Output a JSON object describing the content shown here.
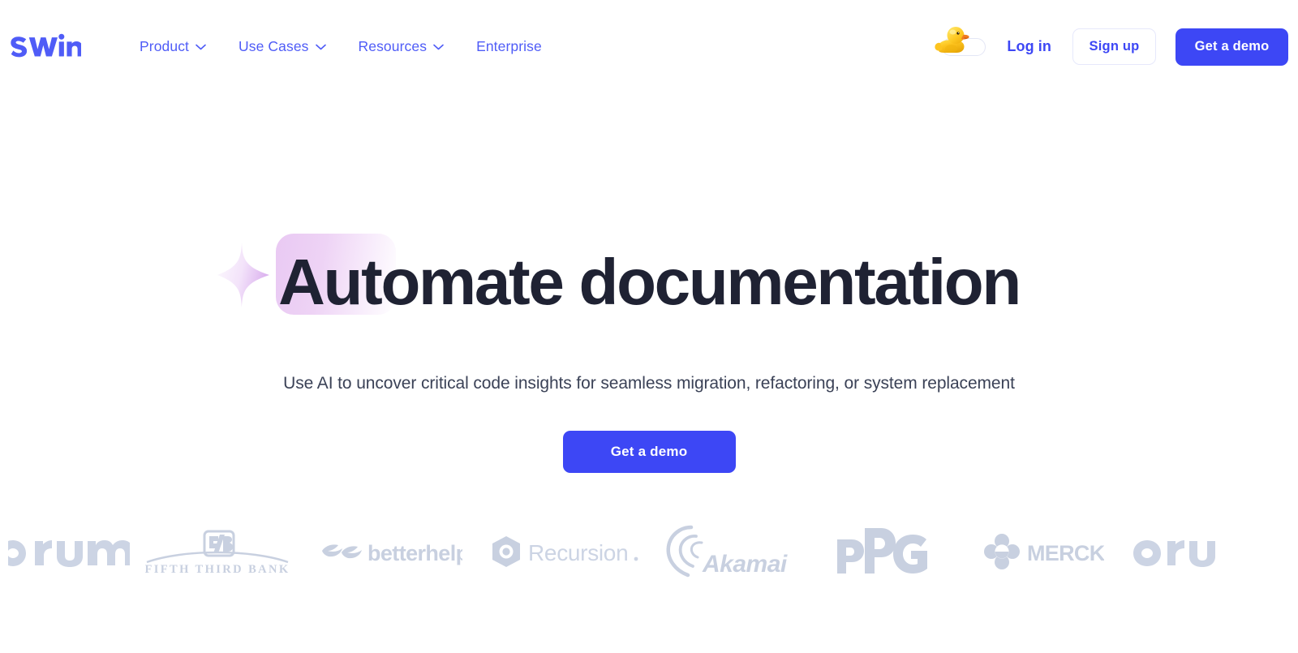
{
  "brand": {
    "name": "swimm",
    "color": "#4f5cf7"
  },
  "header": {
    "nav": [
      {
        "label": "Product",
        "has_chevron": true,
        "icon": "chevron-down-icon"
      },
      {
        "label": "Use Cases",
        "has_chevron": true,
        "icon": "chevron-down-icon"
      },
      {
        "label": "Resources",
        "has_chevron": true,
        "icon": "chevron-down-icon"
      },
      {
        "label": "Enterprise",
        "has_chevron": false,
        "icon": ""
      }
    ],
    "theme_toggle": {
      "icon": "rubber-duck-icon",
      "state": "off",
      "label": ""
    },
    "login_label": "Log in",
    "signup_label": "Sign up",
    "demo_label": "Get a demo"
  },
  "hero": {
    "title": "Automate documentation",
    "sparkle_icon": "sparkle-star-icon",
    "subtitle": "Use AI to uncover critical code insights for seamless migration, refactoring, or system replacement",
    "cta_label": "Get a demo",
    "highlight_color": "#e9c9f3",
    "accent_color": "#3d47f5",
    "title_color": "#1f2233"
  },
  "logo_marquee": {
    "color": "#c7cfdf",
    "items": [
      {
        "name": "optum",
        "label": "otum",
        "icon": "optum-logo",
        "truncated": "left"
      },
      {
        "name": "fifth-third-bank",
        "label": "FIFTH THIRD BANK",
        "icon": "fifth-third-bank-logo",
        "truncated": "none"
      },
      {
        "name": "betterhelp",
        "label": "betterhelp",
        "icon": "betterhelp-logo",
        "truncated": "none"
      },
      {
        "name": "recursion",
        "label": "Recursion.",
        "icon": "recursion-logo",
        "truncated": "none"
      },
      {
        "name": "akamai",
        "label": "Akamai",
        "icon": "akamai-logo",
        "truncated": "none"
      },
      {
        "name": "ppg",
        "label": "PPG",
        "icon": "ppg-logo",
        "truncated": "none"
      },
      {
        "name": "merck",
        "label": "MERCK",
        "icon": "merck-logo",
        "truncated": "none"
      },
      {
        "name": "optum-2",
        "label": "Op",
        "icon": "optum-logo",
        "truncated": "right"
      }
    ]
  }
}
